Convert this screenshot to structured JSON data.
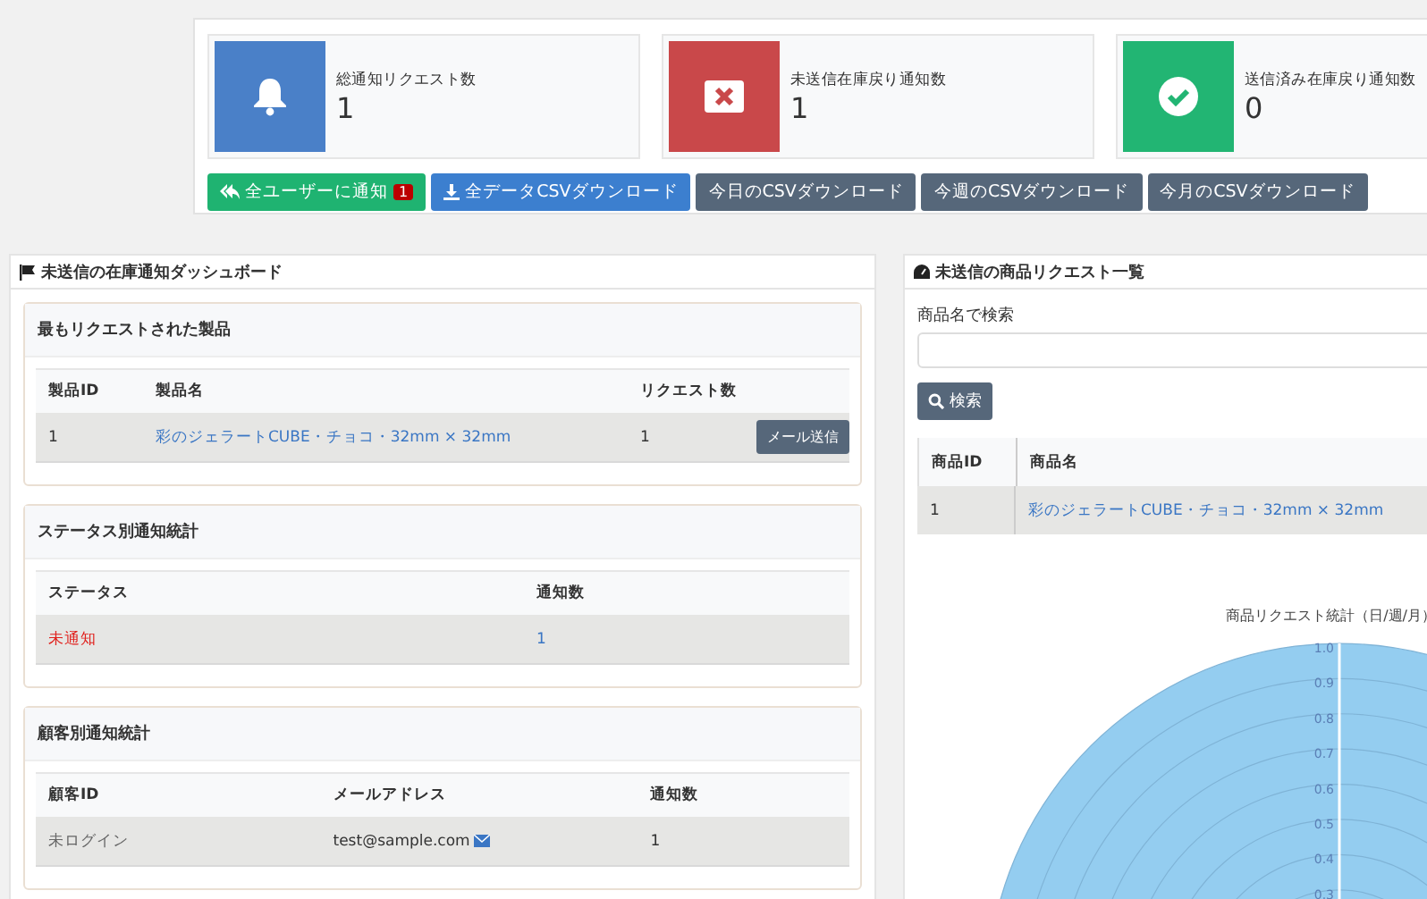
{
  "stats": [
    {
      "kind": "bell",
      "label": "総通知リクエスト数",
      "value": "1"
    },
    {
      "kind": "cross",
      "label": "未送信在庫戻り通知数",
      "value": "1"
    },
    {
      "kind": "check",
      "label": "送信済み在庫戻り通知数",
      "value": "0"
    }
  ],
  "actions": [
    {
      "kind": "notify",
      "label": "全ユーザーに通知",
      "badge": "1"
    },
    {
      "kind": "download",
      "label": "全データCSVダウンロード"
    },
    {
      "kind": "plain",
      "label": "今日のCSVダウンロード"
    },
    {
      "kind": "plain",
      "label": "今週のCSVダウンロード"
    },
    {
      "kind": "plain",
      "label": "今月のCSVダウンロード"
    }
  ],
  "dashboard": {
    "title": "未送信の在庫通知ダッシュボード",
    "sections": [
      {
        "title": "最もリクエストされた製品",
        "columns": [
          "製品ID",
          "製品名",
          "リクエスト数",
          ""
        ],
        "rows": [
          [
            {
              "kind": "text",
              "text": "1"
            },
            {
              "kind": "link",
              "text": "彩のジェラートCUBE・チョコ・32mm × 32mm"
            },
            {
              "kind": "text",
              "text": "1"
            },
            {
              "kind": "button",
              "text": "メール送信"
            }
          ]
        ]
      },
      {
        "title": "ステータス別通知統計",
        "columns": [
          "ステータス",
          "通知数"
        ],
        "rows": [
          [
            {
              "kind": "danger",
              "text": "未通知"
            },
            {
              "kind": "link",
              "text": "1"
            }
          ]
        ]
      },
      {
        "title": "顧客別通知統計",
        "columns": [
          "顧客ID",
          "メールアドレス",
          "通知数"
        ],
        "rows": [
          [
            {
              "kind": "muted",
              "text": "未ログイン"
            },
            {
              "kind": "email",
              "text": "test@sample.com"
            },
            {
              "kind": "text",
              "text": "1"
            }
          ]
        ]
      }
    ]
  },
  "requests": {
    "title": "未送信の商品リクエスト一覧",
    "search_label": "商品名で検索",
    "search_button": "検索",
    "columns": [
      "商品ID",
      "商品名"
    ],
    "rows": [
      [
        "1",
        "彩のジェラートCUBE・チョコ・32mm × 32mm"
      ]
    ],
    "chart_title": "商品リクエスト統計（日/週/月）",
    "radial_ticks": [
      "1.0",
      "0.9",
      "0.8",
      "0.7",
      "0.6",
      "0.5",
      "0.4",
      "0.3"
    ]
  }
}
